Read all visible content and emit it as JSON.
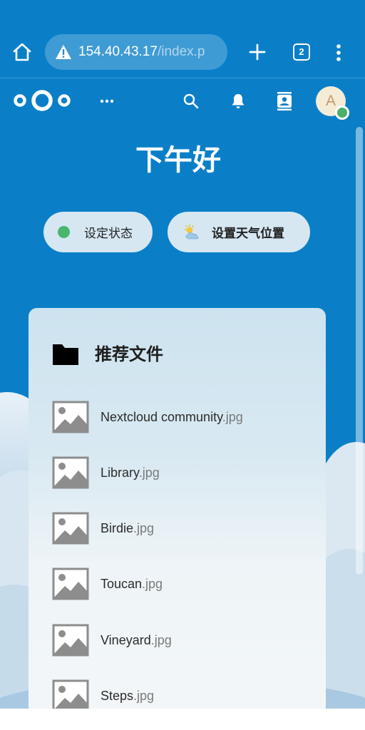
{
  "browser": {
    "url_host": "154.40.43.17",
    "url_path": "/index.p",
    "tab_count": "2"
  },
  "header": {
    "avatar_letter": "A"
  },
  "greeting": "下午好",
  "status_pill": {
    "label": "设定状态",
    "dot_color": "#48b66b"
  },
  "weather_pill": {
    "label": "设置天气位置"
  },
  "recommended": {
    "title": "推荐文件",
    "files": [
      {
        "name": "Nextcloud community",
        "ext": ".jpg"
      },
      {
        "name": "Library",
        "ext": ".jpg"
      },
      {
        "name": "Birdie",
        "ext": ".jpg"
      },
      {
        "name": "Toucan",
        "ext": ".jpg"
      },
      {
        "name": "Vineyard",
        "ext": ".jpg"
      },
      {
        "name": "Steps",
        "ext": ".jpg"
      }
    ]
  },
  "colors": {
    "brand_blue": "#0a7fc8",
    "online_green": "#4caf68"
  }
}
